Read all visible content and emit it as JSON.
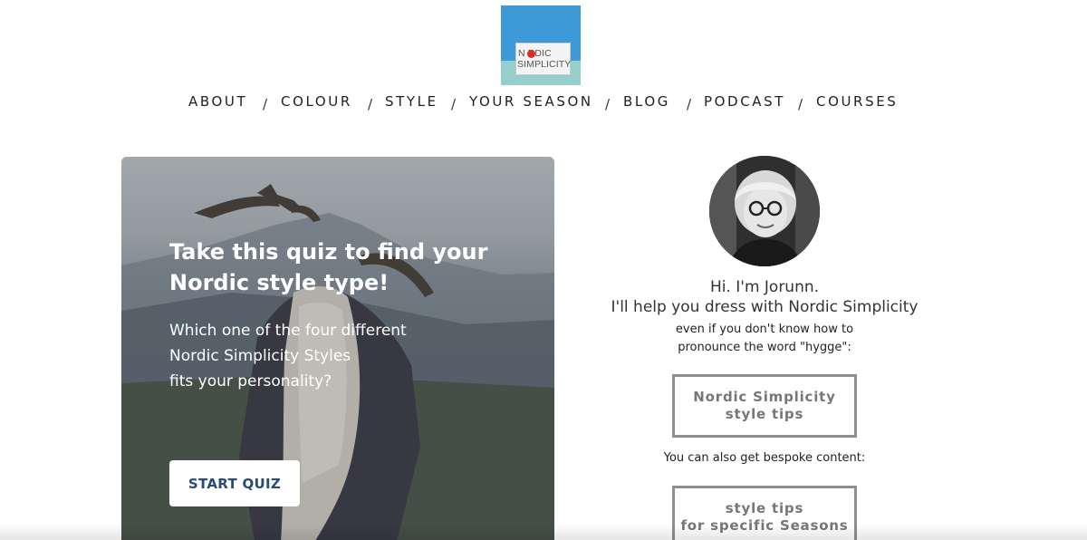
{
  "logo": {
    "word1": "N   RDIC",
    "word2": "SIMPLICITY",
    "colors": {
      "sky": "#3e9ad6",
      "sea": "#94cfcb",
      "dot": "#e02a26"
    }
  },
  "nav": {
    "items": [
      "ABOUT",
      "COLOUR",
      "STYLE",
      "YOUR SEASON",
      "BLOG",
      "PODCAST",
      "COURSES"
    ],
    "separator": "/"
  },
  "hero": {
    "title": "Take this quiz to find your Nordic style type!",
    "text_lines": [
      "Which one of the four different",
      "Nordic Simplicity Styles",
      "fits your personality?"
    ],
    "button_label": "START QUIZ",
    "button_color": "#2b4a73"
  },
  "profile": {
    "greeting": "Hi. I'm Jorunn.",
    "tagline": "I'll help you dress with Nordic Simplicity",
    "sub_line_1": "even if you don't know how to",
    "sub_line_2": "pronounce the word \"hygge\":",
    "button_tips": [
      "Nordic Simplicity",
      "style tips"
    ],
    "bespoke_text": "You can also get bespoke content:",
    "button_seasons": [
      "style tips",
      "for specific Seasons"
    ]
  }
}
